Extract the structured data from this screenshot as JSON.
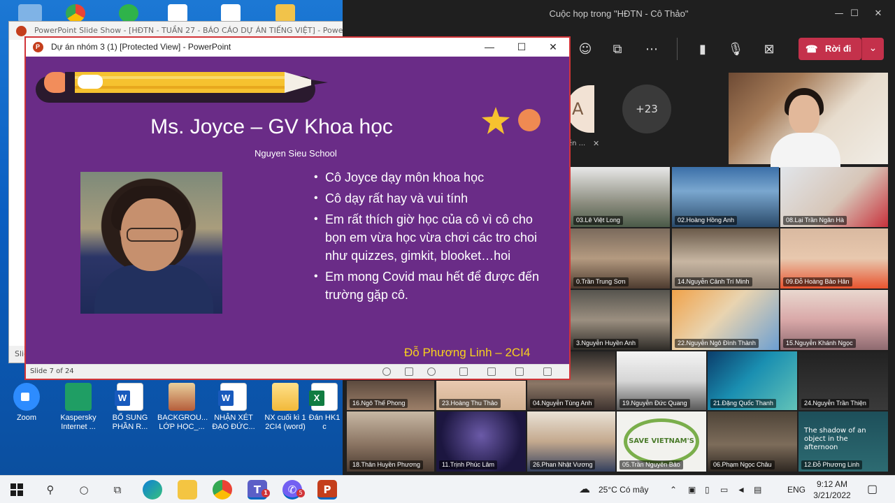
{
  "desktop": {
    "icons": [
      {
        "label": "Zoom",
        "kind": "zoom"
      },
      {
        "label": "Kaspersky Internet ...",
        "kind": "kas"
      },
      {
        "label": "BỔ SUNG PHẦN R...",
        "kind": "word"
      },
      {
        "label": "BACKGROU... LỚP HỌC_...",
        "kind": "img"
      },
      {
        "label": "NHẬN XÉT ĐẠO ĐỨC...",
        "kind": "word"
      },
      {
        "label": "NX cuối kì 1 2CI4 (word)",
        "kind": "folder"
      },
      {
        "label": "Đán HK1 c",
        "kind": "xls"
      }
    ]
  },
  "bg_window": {
    "title": "PowerPoint Slide Show - [HĐTN - TUẦN 27 - BÁO CÁO DỰ ÁN TIẾNG VIỆT] - Powe",
    "footer": "Slid"
  },
  "ppt": {
    "title": "Dự án nhóm 3 (1) [Protected View] - PowerPoint",
    "minimize": "—",
    "maximize": "☐",
    "close": "✕",
    "slide": {
      "title": "Ms. Joyce – GV Khoa học",
      "subtitle": "Nguyen Sieu School",
      "bullets": [
        "Cô Joyce dạy môn khoa học",
        "Cô dạy rất hay và vui tính",
        "Em rất thích giờ học của cô vì cô cho bọn em vừa học vừa chơi các tro choi như quizzes, gimkit, blooket…hoi",
        "Em mong Covid mau hết để được đến trường gặp cô."
      ],
      "author": "Đỗ Phương Linh – 2CI4"
    },
    "status": "Slide 7 of 24"
  },
  "teams": {
    "title": "Cuộc họp trong \"HĐTN - Cô Thảo\"",
    "leave_label": "Rời đi",
    "more_count": "+23",
    "avatar_letter": "A",
    "avatar_name": "ền ...",
    "participants": [
      "03.Lê Việt Long",
      "02.Hoàng Hồng Anh",
      "08.Lại Trần Ngân Hà",
      "0.Trần Trung Sơn",
      "14.Nguyễn Cảnh Trí Minh",
      "09.Đỗ Hoàng Bảo Hân",
      "3.Nguyễn Huyền Anh",
      "22.Nguyễn Ngô Đình Thành",
      "15.Nguyễn Khánh Ngọc",
      "16.Ngô Thế Phong",
      "23.Hoàng Thu Thảo",
      "04.Nguyễn Tùng Anh",
      "19.Nguyễn Đức Quang",
      "21.Đặng Quốc Thanh",
      "24.Nguyễn Trần Thiện",
      "18.Thân Huyền Phương",
      "11.Trịnh Phúc Lâm",
      "26.Phan Nhật Vương",
      "05.Trần Nguyên Bảo",
      "06.Phạm Ngọc Châu",
      "12.Đỗ Phương Linh"
    ],
    "tile_texts": {
      "save": "SAVE VIETNAM'S",
      "shadow": "The shadow of an object in the afternoon"
    }
  },
  "taskbar": {
    "weather": "25°C  Có mây",
    "lang": "ENG",
    "time": "9:12 AM",
    "date": "3/21/2022",
    "teams_badge": "1",
    "viber_badge": "5"
  }
}
